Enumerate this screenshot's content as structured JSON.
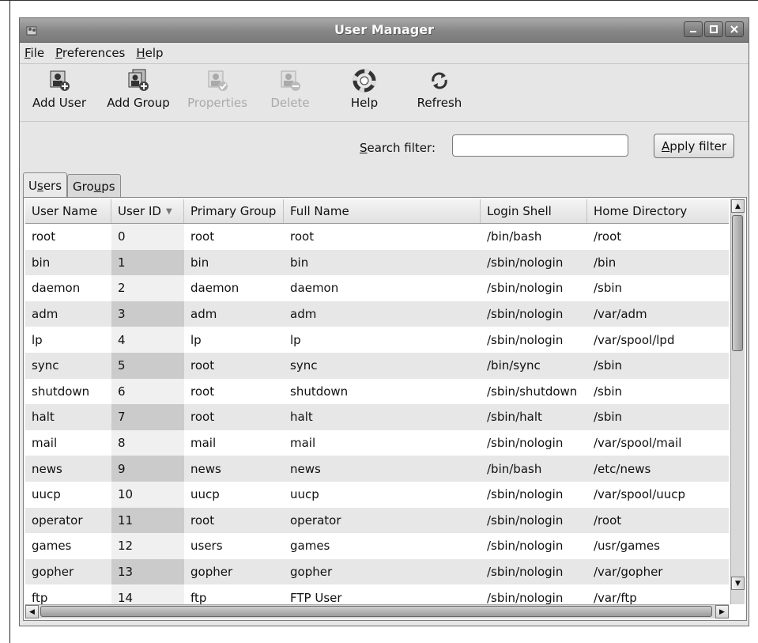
{
  "window": {
    "title": "User Manager"
  },
  "menu": [
    {
      "pre": "",
      "mnemonic": "F",
      "post": "ile"
    },
    {
      "pre": "",
      "mnemonic": "P",
      "post": "references"
    },
    {
      "pre": "",
      "mnemonic": "H",
      "post": "elp"
    }
  ],
  "toolbar": {
    "add_user": "Add User",
    "add_group": "Add Group",
    "properties": "Properties",
    "delete": "Delete",
    "help": "Help",
    "refresh": "Refresh",
    "disabled": [
      "Properties",
      "Delete"
    ]
  },
  "search": {
    "label_mnemonic": "S",
    "label_rest": "earch filter:",
    "value": "",
    "apply_mnemonic": "A",
    "apply_rest": "pply filter"
  },
  "tabs": {
    "users": {
      "pre": "U",
      "mnemonic": "s",
      "post": "ers",
      "active": true
    },
    "groups": {
      "pre": "Gro",
      "mnemonic": "u",
      "post": "ps",
      "active": false
    }
  },
  "table": {
    "columns": [
      "User Name",
      "User ID",
      "Primary Group",
      "Full Name",
      "Login Shell",
      "Home Directory"
    ],
    "sorted_column": "User ID",
    "rows": [
      [
        "root",
        "0",
        "root",
        "root",
        "/bin/bash",
        "/root"
      ],
      [
        "bin",
        "1",
        "bin",
        "bin",
        "/sbin/nologin",
        "/bin"
      ],
      [
        "daemon",
        "2",
        "daemon",
        "daemon",
        "/sbin/nologin",
        "/sbin"
      ],
      [
        "adm",
        "3",
        "adm",
        "adm",
        "/sbin/nologin",
        "/var/adm"
      ],
      [
        "lp",
        "4",
        "lp",
        "lp",
        "/sbin/nologin",
        "/var/spool/lpd"
      ],
      [
        "sync",
        "5",
        "root",
        "sync",
        "/bin/sync",
        "/sbin"
      ],
      [
        "shutdown",
        "6",
        "root",
        "shutdown",
        "/sbin/shutdown",
        "/sbin"
      ],
      [
        "halt",
        "7",
        "root",
        "halt",
        "/sbin/halt",
        "/sbin"
      ],
      [
        "mail",
        "8",
        "mail",
        "mail",
        "/sbin/nologin",
        "/var/spool/mail"
      ],
      [
        "news",
        "9",
        "news",
        "news",
        "/bin/bash",
        "/etc/news"
      ],
      [
        "uucp",
        "10",
        "uucp",
        "uucp",
        "/sbin/nologin",
        "/var/spool/uucp"
      ],
      [
        "operator",
        "11",
        "root",
        "operator",
        "/sbin/nologin",
        "/root"
      ],
      [
        "games",
        "12",
        "users",
        "games",
        "/sbin/nologin",
        "/usr/games"
      ],
      [
        "gopher",
        "13",
        "gopher",
        "gopher",
        "/sbin/nologin",
        "/var/gopher"
      ],
      [
        "ftp",
        "14",
        "ftp",
        "FTP User",
        "/sbin/nologin",
        "/var/ftp"
      ]
    ]
  }
}
